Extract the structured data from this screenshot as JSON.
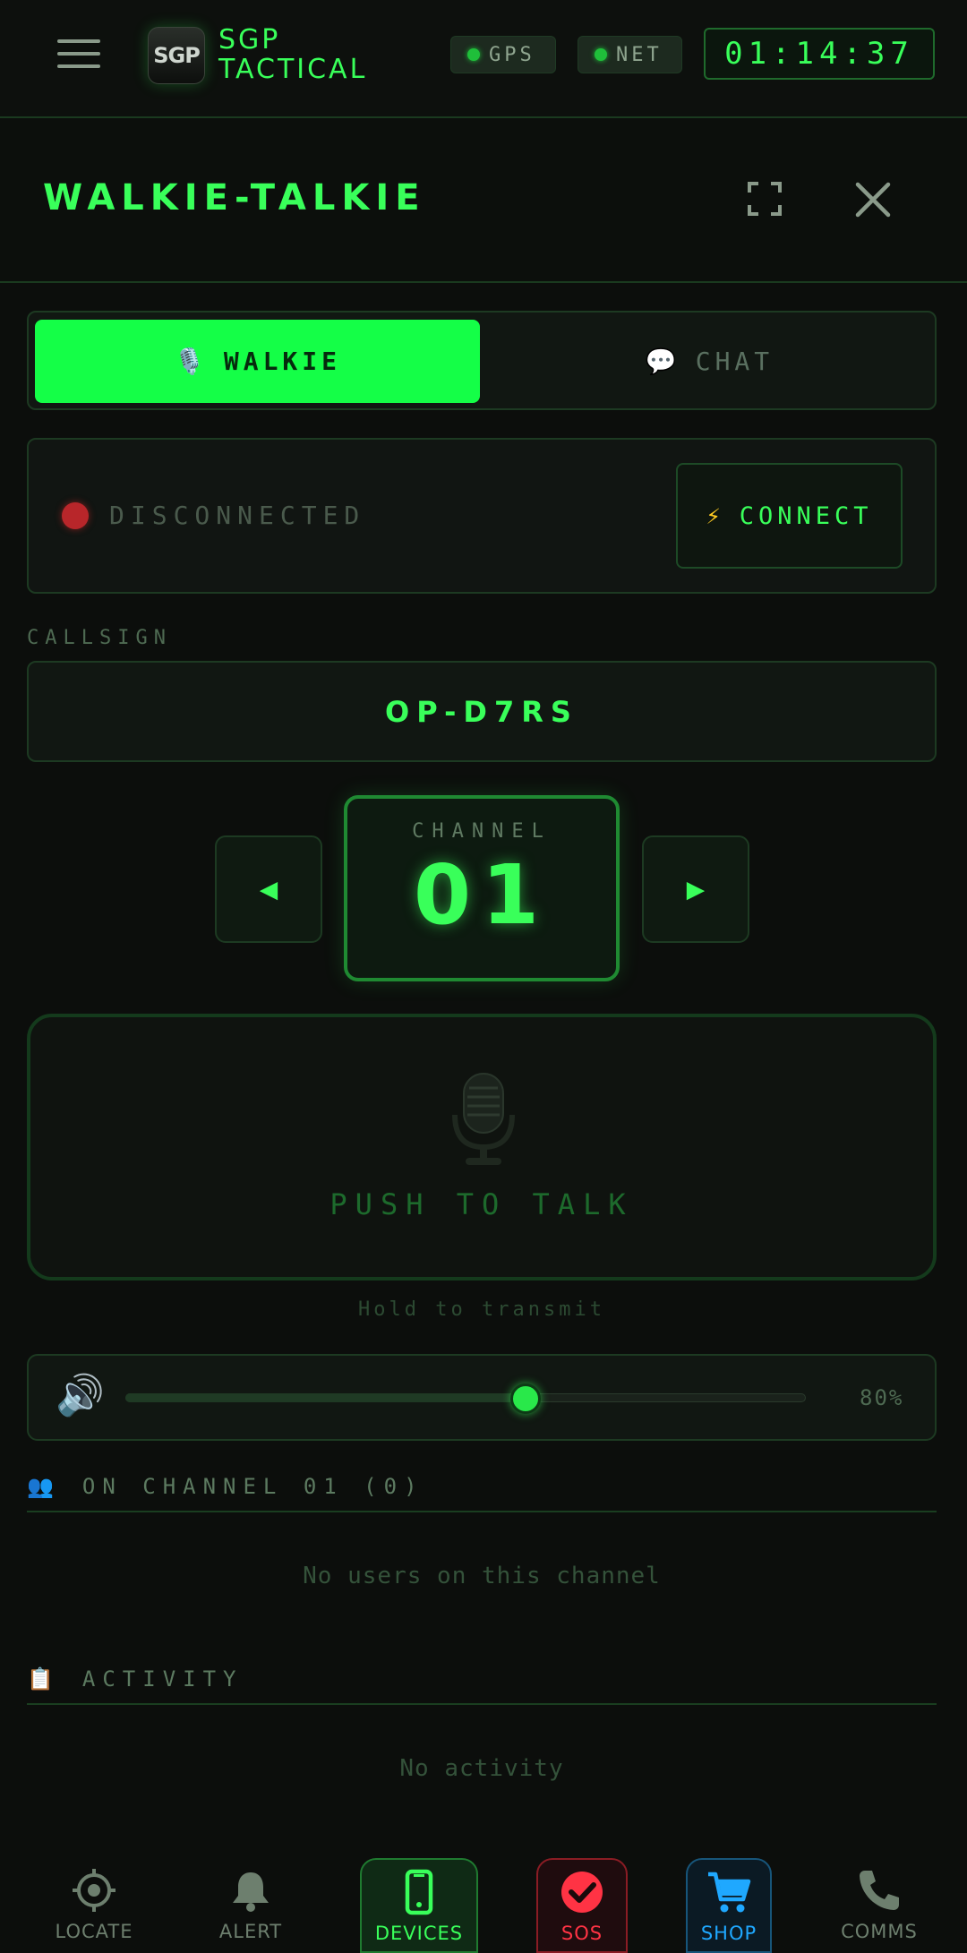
{
  "header": {
    "logo_text": "SGP",
    "brand_line1": "SGP",
    "brand_line2": "TACTICAL",
    "gps_label": "GPS",
    "net_label": "NET",
    "clock": "01:14:37"
  },
  "panel": {
    "title": "WALKIE-TALKIE"
  },
  "tabs": {
    "walkie": {
      "icon": "🎙️",
      "label": "WALKIE"
    },
    "chat": {
      "icon": "💬",
      "label": "CHAT"
    }
  },
  "connection": {
    "status": "DISCONNECTED",
    "connect_icon": "⚡",
    "connect_label": "CONNECT",
    "status_color": "#b8262a"
  },
  "callsign": {
    "label": "CALLSIGN",
    "value": "OP-D7RS"
  },
  "channel": {
    "label": "CHANNEL",
    "number": "01",
    "prev_symbol": "◀",
    "next_symbol": "▶"
  },
  "ptt": {
    "label": "PUSH TO TALK",
    "hint": "Hold to transmit"
  },
  "volume": {
    "icon": "🔊",
    "percent_value": 80,
    "display": "80%"
  },
  "users": {
    "icon": "👥",
    "heading": "ON CHANNEL 01 (0)",
    "empty": "No users on this channel"
  },
  "activity": {
    "icon": "📋",
    "heading": "ACTIVITY",
    "empty": "No activity"
  },
  "nav": {
    "locate": "LOCATE",
    "alert": "ALERT",
    "devices": "DEVICES",
    "sos": "SOS",
    "shop": "SHOP",
    "comms": "COMMS"
  },
  "colors": {
    "accent": "#39ff5a",
    "tab_active_bg": "#14ff47",
    "sos": "#ff3344",
    "shop": "#1fa8ff"
  }
}
